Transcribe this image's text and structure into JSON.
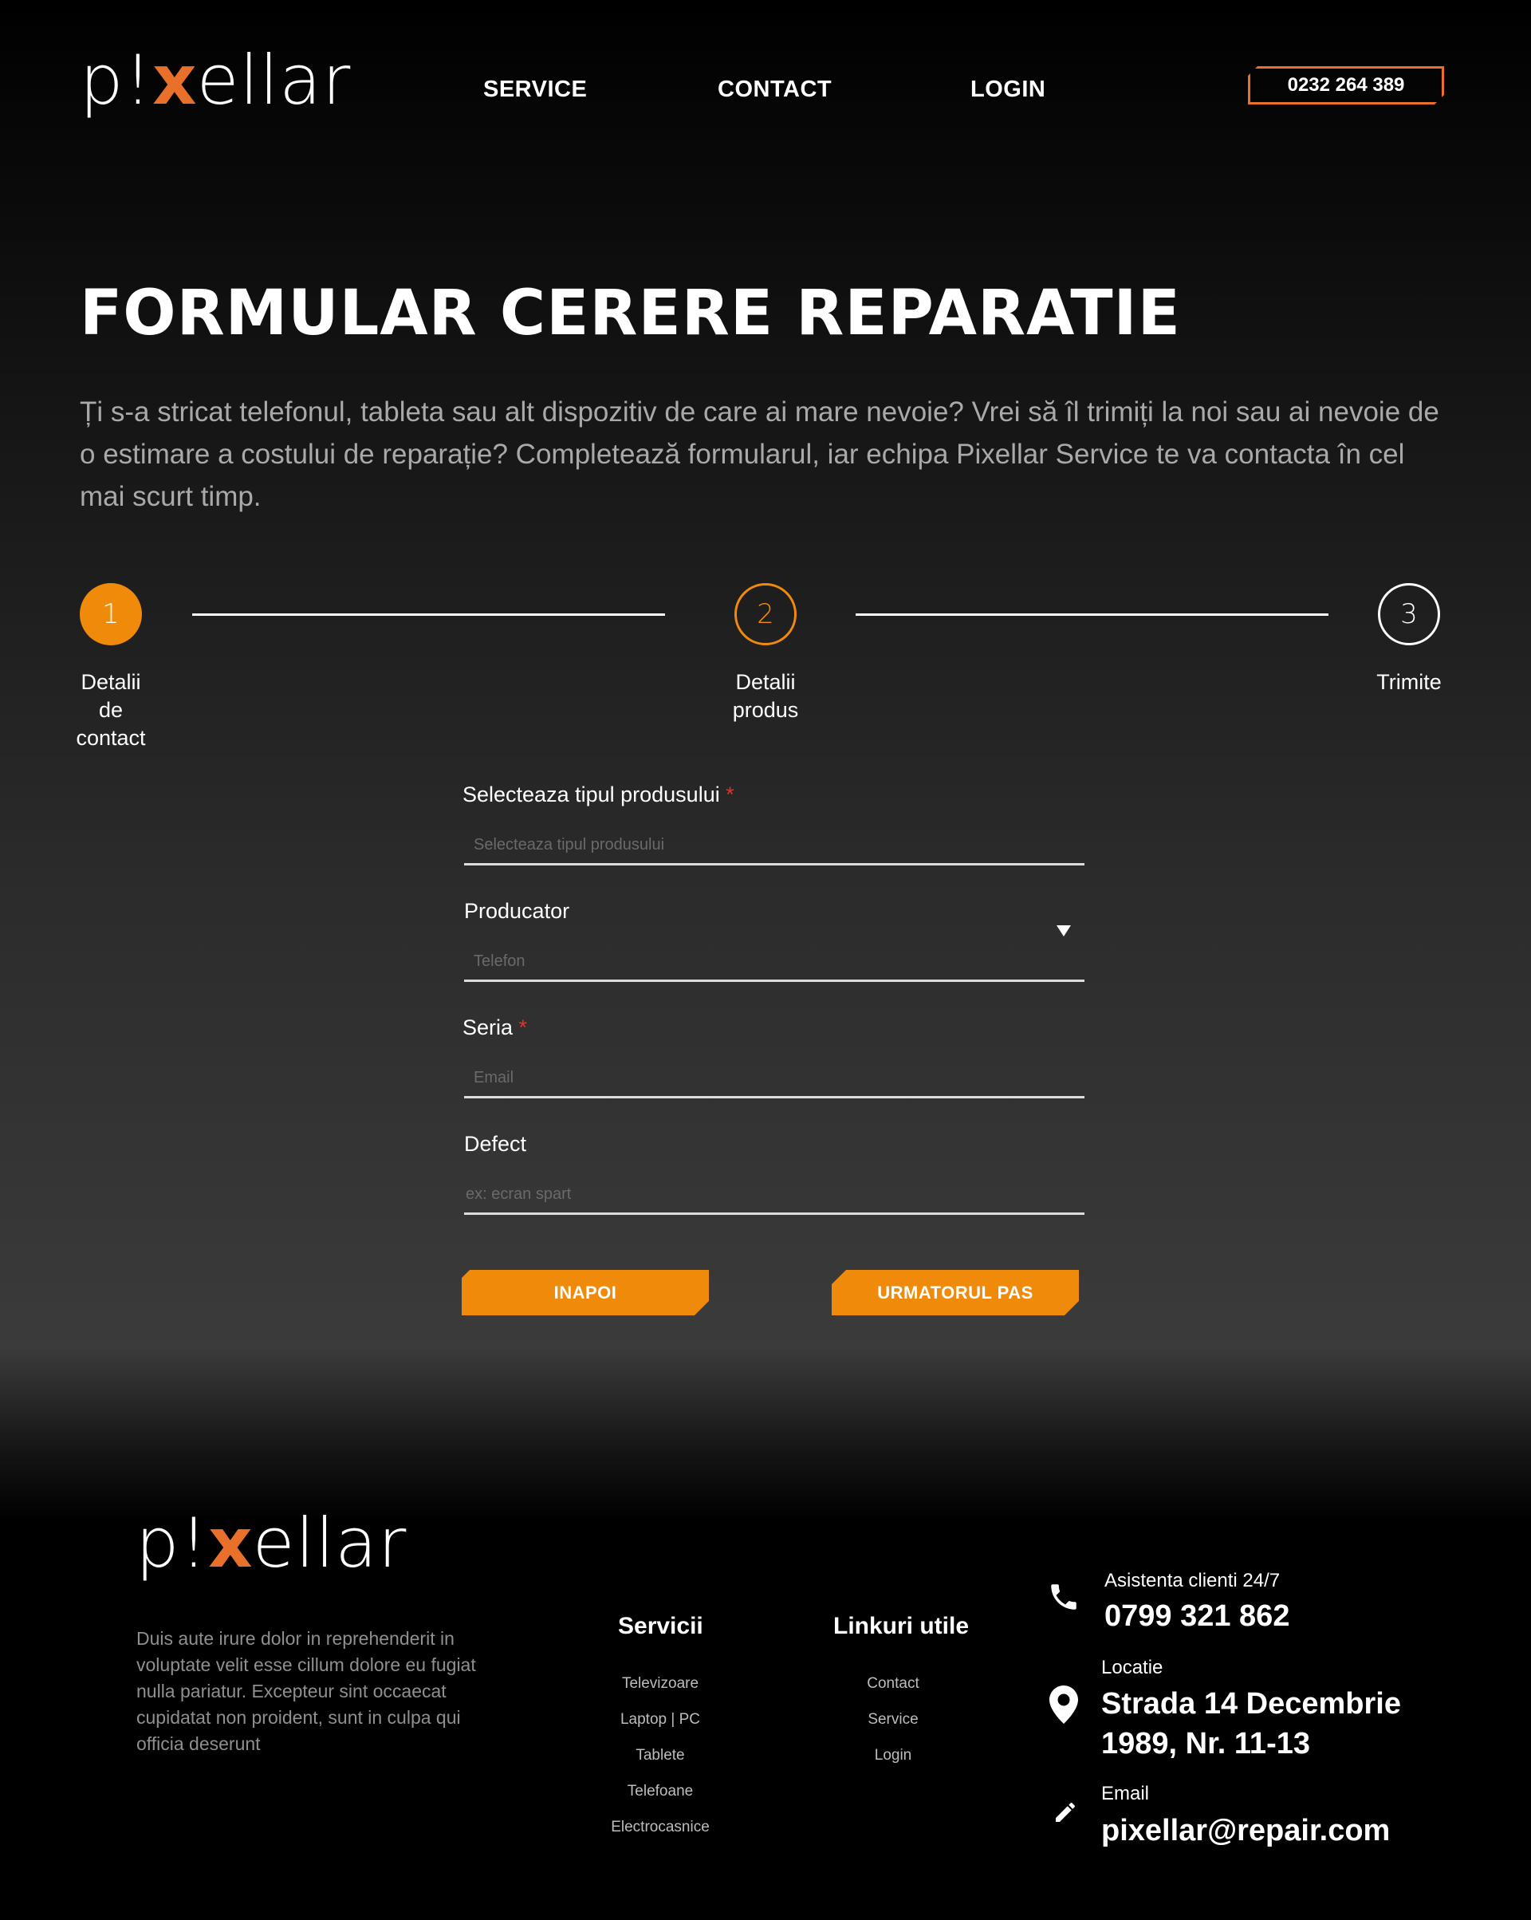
{
  "brand": {
    "logo_left": "p!",
    "logo_x": "x",
    "logo_right": "ellar"
  },
  "nav": {
    "service": "SERVICE",
    "contact": "CONTACT",
    "login": "LOGIN"
  },
  "header": {
    "phone": "0232 264 389"
  },
  "page": {
    "title": "FORMULAR CERERE REPARATIE",
    "intro": "Ți s-a stricat telefonul, tableta sau alt dispozitiv de care ai mare nevoie? Vrei să îl trimiți la noi sau ai nevoie de o estimare a costului de reparație? Completează formularul, iar echipa Pixellar Service te va contacta în cel mai scurt timp."
  },
  "steps": [
    {
      "number": "1",
      "label_lines": [
        "Detalii",
        "de",
        "contact"
      ],
      "state": "completed"
    },
    {
      "number": "2",
      "label_lines": [
        "Detalii",
        "produs"
      ],
      "state": "active"
    },
    {
      "number": "3",
      "label_lines": [
        "Trimite"
      ],
      "state": "pending"
    }
  ],
  "form": {
    "product_type": {
      "label": "Selecteaza tipul produsului",
      "required": "*",
      "placeholder": "Selecteaza tipul produsului"
    },
    "manufacturer": {
      "label": "Producator",
      "placeholder": "Telefon"
    },
    "series": {
      "label": "Seria",
      "required": "*",
      "placeholder": "Email"
    },
    "defect": {
      "label": "Defect",
      "placeholder": "ex: ecran spart"
    },
    "back_label": "INAPOI",
    "next_label": "URMATORUL PAS"
  },
  "footer": {
    "description": "Duis aute irure dolor in reprehenderit in voluptate velit esse cillum dolore eu fugiat nulla pariatur. Excepteur sint occaecat cupidatat non proident, sunt in culpa qui officia deserunt",
    "services_heading": "Servicii",
    "services": [
      "Televizoare",
      "Laptop | PC",
      "Tablete",
      "Telefoane",
      "Electrocasnice"
    ],
    "links_heading": "Linkuri utile",
    "links": [
      "Contact",
      "Service",
      "Login"
    ],
    "support_label": "Asistenta clienti 24/7",
    "support_phone": "0799 321 862",
    "location_label": "Locatie",
    "location_line1": "Strada 14 Decembrie",
    "location_line2": "1989, Nr. 11-13",
    "email_label": "Email",
    "email": "pixellar@repair.com"
  },
  "colors": {
    "accent": "#f08a0a",
    "brand_x": "#e8702a",
    "required": "#d9362a"
  },
  "icons": [
    "phone-icon",
    "location-pin-icon",
    "pencil-icon",
    "dropdown-arrow-icon"
  ]
}
